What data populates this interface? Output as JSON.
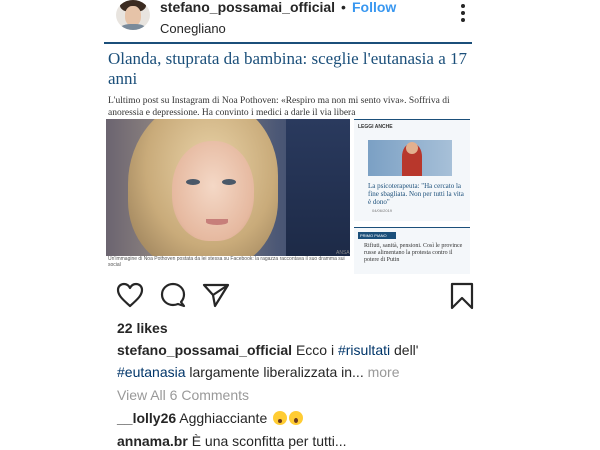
{
  "post": {
    "username": "stefano_possamai_official",
    "separator": "•",
    "follow_label": "Follow",
    "location": "Conegliano"
  },
  "article": {
    "headline": "Olanda, stuprata da bambina: sceglie l'eutanasia a 17 anni",
    "subhead": "L'ultimo post su Instagram di Noa Pothoven: «Respiro ma non mi sento viva». Soffriva di anoressia e depressione. Ha convinto i medici a darle il via libera",
    "caption": "Un'immagine di Noa Pothoven postata da lei stessa su Facebook: la ragazza raccontava il suo dramma sui social",
    "credit": "ANSA",
    "leggi_anche_title": "LEGGI ANCHE",
    "leggi_anche_text": "La psicoterapeuta: \"Ha cercato la fine sbagliata. Non per tutti la vita è dono\"",
    "leggi_anche_date": "04/06/2019",
    "primo_piano_tag": "PRIMO PIANO",
    "primo_piano_text": "Rifiuti, sanità, pensioni. Così le province russe alimentano la protesta contro il potere di Putin"
  },
  "engagement": {
    "likes": "22 likes",
    "caption_user": "stefano_possamai_official",
    "caption_pre": " Ecco i ",
    "hashtag1": "#risultati",
    "caption_mid": " dell'",
    "hashtag2": "#eutanasia",
    "caption_post": " largamente liberalizzata in...",
    "more_label": " more",
    "view_all": "View All 6 Comments"
  },
  "comments": [
    {
      "user": "__lolly26",
      "text": " Agghiacciante "
    },
    {
      "user": "annama.br",
      "text": " È una  sconfitta per tutti..."
    }
  ],
  "icons": {
    "heart": "heart-icon",
    "comment": "comment-icon",
    "share": "share-icon",
    "save": "bookmark-icon",
    "more": "more-vertical-icon"
  },
  "colors": {
    "follow": "#3897f0",
    "hashtag": "#003569",
    "headline": "#1b4f7a",
    "muted": "#999999"
  }
}
